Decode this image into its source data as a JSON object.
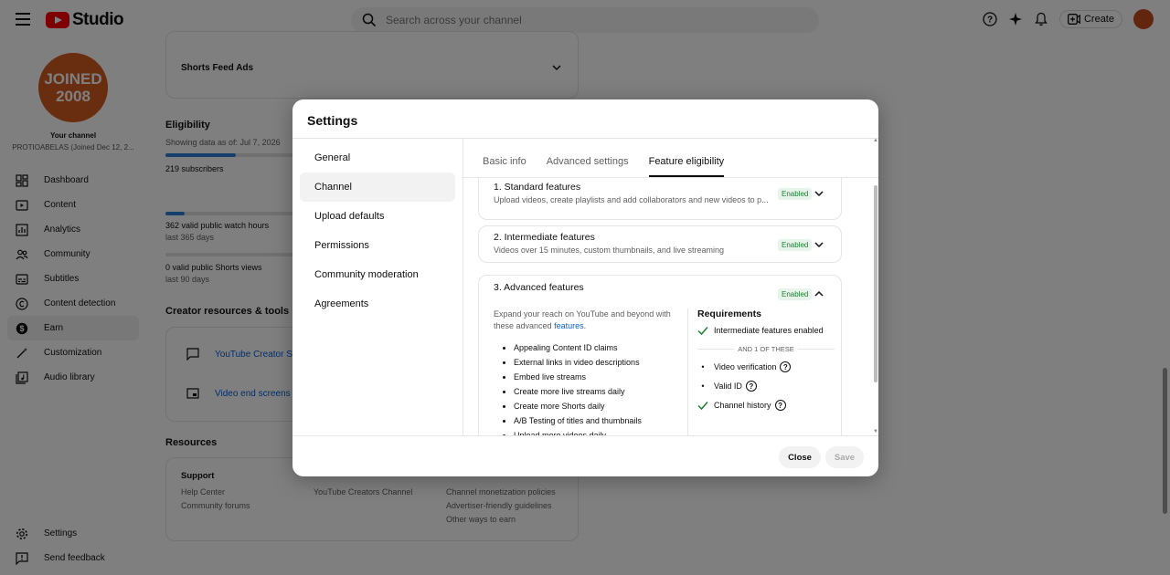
{
  "app": {
    "logo_text": "Studio",
    "brand_color": "#ff0000"
  },
  "search": {
    "placeholder": "Search across your channel"
  },
  "topbar": {
    "create_label": "Create"
  },
  "sidebar": {
    "avatar_text_line1": "JOINED",
    "avatar_text_line2": "2008",
    "your_channel": "Your channel",
    "channel_name": "PROTIOABELAS (Joined Dec 12, 2...",
    "items": [
      {
        "label": "Dashboard",
        "icon": "dashboard-icon"
      },
      {
        "label": "Content",
        "icon": "content-icon"
      },
      {
        "label": "Analytics",
        "icon": "analytics-icon"
      },
      {
        "label": "Community",
        "icon": "community-icon"
      },
      {
        "label": "Subtitles",
        "icon": "subtitles-icon"
      },
      {
        "label": "Content detection",
        "icon": "copyright-icon"
      },
      {
        "label": "Earn",
        "icon": "dollar-icon"
      },
      {
        "label": "Customization",
        "icon": "magic-wand-icon"
      },
      {
        "label": "Audio library",
        "icon": "audio-library-icon"
      }
    ],
    "bottom_items": [
      {
        "label": "Settings",
        "icon": "gear-icon"
      },
      {
        "label": "Send feedback",
        "icon": "feedback-icon"
      }
    ]
  },
  "background": {
    "shorts_feed_ads": "Shorts Feed Ads",
    "eligibility_title": "Eligibility",
    "showing_data": "Showing data as of: Jul 7, 2026",
    "subscribers": "219 subscribers",
    "subscribers_progress": 0.55,
    "watch_hours": "362 valid public watch hours",
    "watch_hours_period": "last 365 days",
    "watch_hours_progress": 0.15,
    "shorts_views": "0 valid public Shorts views",
    "shorts_views_period": "last 90 days",
    "shorts_views_progress": 0.0,
    "creator_resources_title": "Creator resources & tools",
    "creator_link_1": "YouTube Creator Su",
    "creator_link_2": "Video end screens",
    "resources_title": "Resources",
    "support_title": "Support",
    "help_center": "Help Center",
    "community_forums": "Community forums",
    "creators_channel": "YouTube Creators Channel",
    "monetization_policies": "Channel monetization policies",
    "advertiser_guidelines": "Advertiser-friendly guidelines",
    "other_ways": "Other ways to earn"
  },
  "dialog": {
    "title": "Settings",
    "nav": [
      "General",
      "Channel",
      "Upload defaults",
      "Permissions",
      "Community moderation",
      "Agreements"
    ],
    "active_nav": "Channel",
    "tabs": [
      "Basic info",
      "Advanced settings",
      "Feature eligibility"
    ],
    "active_tab": "Feature eligibility",
    "features": [
      {
        "title": "1. Standard features",
        "desc": "Upload videos, create playlists and add collaborators and new videos to p...",
        "status": "Enabled"
      },
      {
        "title": "2. Intermediate features",
        "desc": "Videos over 15 minutes, custom thumbnails, and live streaming",
        "status": "Enabled"
      },
      {
        "title": "3. Advanced features",
        "status": "Enabled"
      }
    ],
    "advanced": {
      "intro": "Expand your reach on YouTube and beyond with these advanced",
      "intro_link": "features",
      "list": [
        "Appealing Content ID claims",
        "External links in video descriptions",
        "Embed live streams",
        "Create more live streams daily",
        "Create more Shorts daily",
        "A/B Testing of titles and thumbnails",
        "Upload more videos daily"
      ],
      "requirements_title": "Requirements",
      "req_met": "Intermediate features enabled",
      "divider": "AND 1 OF THESE",
      "options": [
        {
          "label": "Video verification",
          "met": false
        },
        {
          "label": "Valid ID",
          "met": false
        },
        {
          "label": "Channel history",
          "met": true
        }
      ]
    },
    "close_label": "Close",
    "save_label": "Save",
    "status_color": "#1e7e34"
  }
}
